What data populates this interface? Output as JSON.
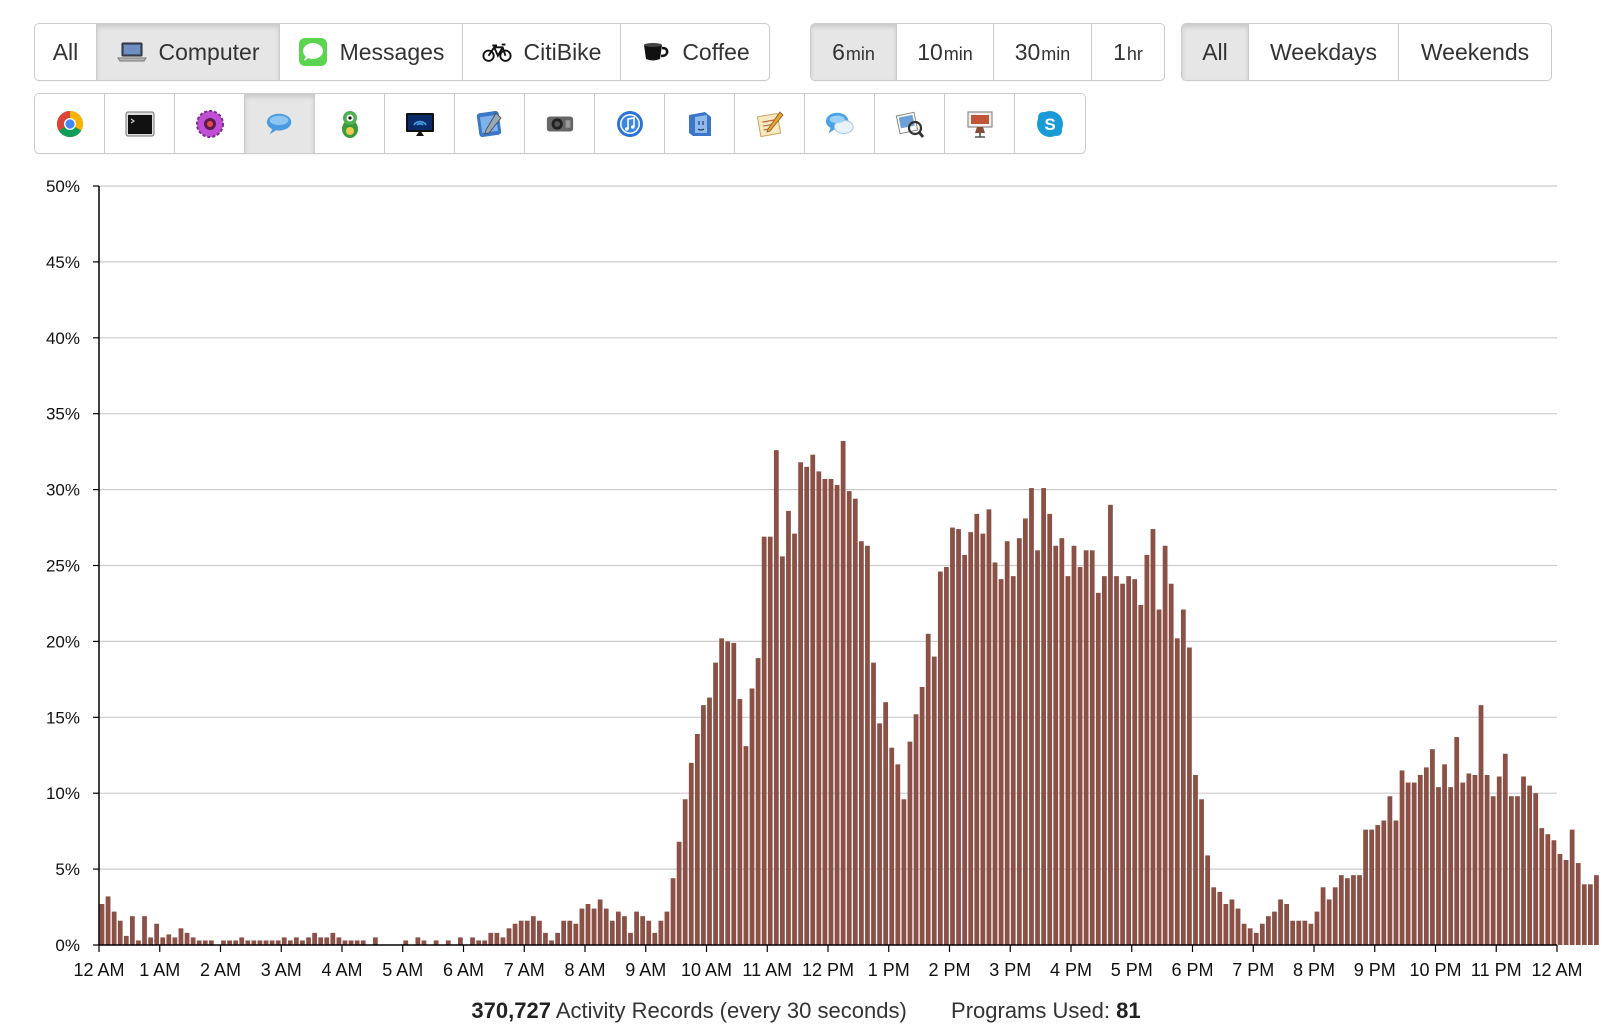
{
  "filters": {
    "source": [
      {
        "label": "All",
        "icon": ""
      },
      {
        "label": "Computer",
        "icon": "laptop-icon"
      },
      {
        "label": "Messages",
        "icon": "messages-icon"
      },
      {
        "label": "CitiBike",
        "icon": "bicycle-icon"
      },
      {
        "label": "Coffee",
        "icon": "coffee-cup-icon"
      }
    ],
    "source_active": "Computer",
    "interval": [
      {
        "num": "6",
        "unit": "min"
      },
      {
        "num": "10",
        "unit": "min"
      },
      {
        "num": "30",
        "unit": "min"
      },
      {
        "num": "1",
        "unit": "hr"
      }
    ],
    "interval_active": "6 min",
    "days": [
      "All",
      "Weekdays",
      "Weekends"
    ],
    "days_active": "All"
  },
  "apps": [
    {
      "name": "chrome-icon",
      "color": "#4285f4"
    },
    {
      "name": "terminal-icon",
      "color": "#222222"
    },
    {
      "name": "flower-app-icon",
      "color": "#b44bc8"
    },
    {
      "name": "chat-bubbles-icon",
      "color": "#3b8fd8"
    },
    {
      "name": "adium-duck-icon",
      "color": "#3c9a3c"
    },
    {
      "name": "airplay-monitor-icon",
      "color": "#1b3a8a"
    },
    {
      "name": "xcode-icon",
      "color": "#3a78c8"
    },
    {
      "name": "facetime-camera-icon",
      "color": "#555555"
    },
    {
      "name": "itunes-icon",
      "color": "#2a74d8"
    },
    {
      "name": "finder-icon",
      "color": "#3d76c9"
    },
    {
      "name": "textedit-icon",
      "color": "#e2a33a"
    },
    {
      "name": "messages-bubbles-icon",
      "color": "#4aa3e8"
    },
    {
      "name": "preview-icon",
      "color": "#5d6f8a"
    },
    {
      "name": "keynote-icon",
      "color": "#8a4a3a"
    },
    {
      "name": "skype-icon",
      "color": "#1a9bd8"
    }
  ],
  "apps_active_index": 3,
  "chart_data": {
    "type": "bar",
    "bar_color": "#8b5147",
    "ylim": [
      0,
      50
    ],
    "yticks": [
      "0%",
      "5%",
      "10%",
      "15%",
      "20%",
      "25%",
      "30%",
      "35%",
      "40%",
      "45%",
      "50%"
    ],
    "xticks": [
      "12 AM",
      "1 AM",
      "2 AM",
      "3 AM",
      "4 AM",
      "5 AM",
      "6 AM",
      "7 AM",
      "8 AM",
      "9 AM",
      "10 AM",
      "11 AM",
      "12 PM",
      "1 PM",
      "2 PM",
      "3 PM",
      "4 PM",
      "5 PM",
      "6 PM",
      "7 PM",
      "8 PM",
      "9 PM",
      "10 PM",
      "11 PM",
      "12 AM"
    ],
    "bin_minutes": 6,
    "values": [
      2.7,
      3.2,
      2.2,
      1.6,
      0.6,
      1.9,
      0.3,
      1.9,
      0.5,
      1.4,
      0.5,
      0.7,
      0.5,
      1.1,
      0.8,
      0.5,
      0.3,
      0.3,
      0.3,
      0,
      0.3,
      0.3,
      0.3,
      0.5,
      0.3,
      0.3,
      0.3,
      0.3,
      0.3,
      0.3,
      0.5,
      0.3,
      0.5,
      0.3,
      0.5,
      0.8,
      0.5,
      0.5,
      0.8,
      0.5,
      0.3,
      0.3,
      0.3,
      0.3,
      0,
      0.5,
      0,
      0,
      0,
      0,
      0.3,
      0,
      0.5,
      0.3,
      0,
      0.3,
      0,
      0.3,
      0,
      0.5,
      0,
      0.5,
      0.3,
      0.3,
      0.8,
      0.8,
      0.5,
      1.1,
      1.4,
      1.6,
      1.6,
      1.9,
      1.6,
      0.8,
      0.3,
      0.8,
      1.6,
      1.6,
      1.4,
      2.4,
      2.7,
      2.4,
      3.0,
      2.4,
      1.6,
      2.2,
      1.9,
      0.8,
      2.2,
      1.9,
      1.6,
      0.8,
      1.6,
      2.2,
      4.4,
      6.8,
      9.6,
      12.0,
      13.9,
      15.8,
      16.3,
      18.6,
      20.2,
      20.0,
      19.9,
      16.2,
      13.1,
      16.9,
      18.9,
      26.9,
      26.9,
      32.6,
      25.6,
      28.6,
      27.1,
      31.8,
      31.5,
      32.3,
      31.2,
      30.7,
      30.7,
      30.3,
      33.2,
      29.9,
      29.4,
      26.6,
      26.3,
      18.6,
      14.6,
      16.0,
      13.0,
      11.9,
      9.6,
      13.4,
      15.2,
      17.0,
      20.5,
      19.0,
      24.6,
      24.9,
      27.5,
      27.4,
      25.7,
      27.2,
      28.4,
      27.1,
      28.7,
      25.2,
      24.1,
      26.6,
      24.3,
      26.8,
      28.1,
      30.1,
      26.0,
      30.1,
      28.4,
      26.3,
      26.8,
      24.3,
      26.3,
      24.9,
      26.0,
      26.0,
      23.2,
      24.3,
      29.0,
      24.3,
      23.8,
      24.3,
      24.1,
      22.4,
      25.7,
      27.4,
      22.1,
      26.3,
      23.8,
      20.2,
      22.1,
      19.6,
      11.2,
      9.6,
      5.9,
      3.8,
      3.5,
      2.7,
      3.0,
      2.4,
      1.4,
      1.1,
      0.8,
      1.4,
      1.9,
      2.2,
      3.0,
      2.7,
      1.6,
      1.6,
      1.6,
      1.4,
      2.2,
      3.8,
      3.0,
      3.8,
      4.6,
      4.4,
      4.6,
      4.6,
      7.6,
      7.6,
      7.9,
      8.2,
      9.8,
      8.2,
      11.5,
      10.7,
      10.7,
      11.2,
      11.7,
      12.9,
      10.4,
      11.9,
      10.4,
      13.7,
      10.7,
      11.3,
      11.2,
      15.8,
      11.2,
      9.8,
      11.1,
      12.6,
      9.8,
      9.8,
      11.1,
      10.5,
      10.0,
      7.7,
      7.3,
      6.9,
      6.0,
      5.6,
      7.6,
      5.4,
      4.0,
      4.0,
      4.6
    ]
  },
  "footer": {
    "records_count": "370,727",
    "records_label": "Activity Records (every 30 seconds)",
    "programs_label": "Programs Used:",
    "programs_count": "81"
  }
}
